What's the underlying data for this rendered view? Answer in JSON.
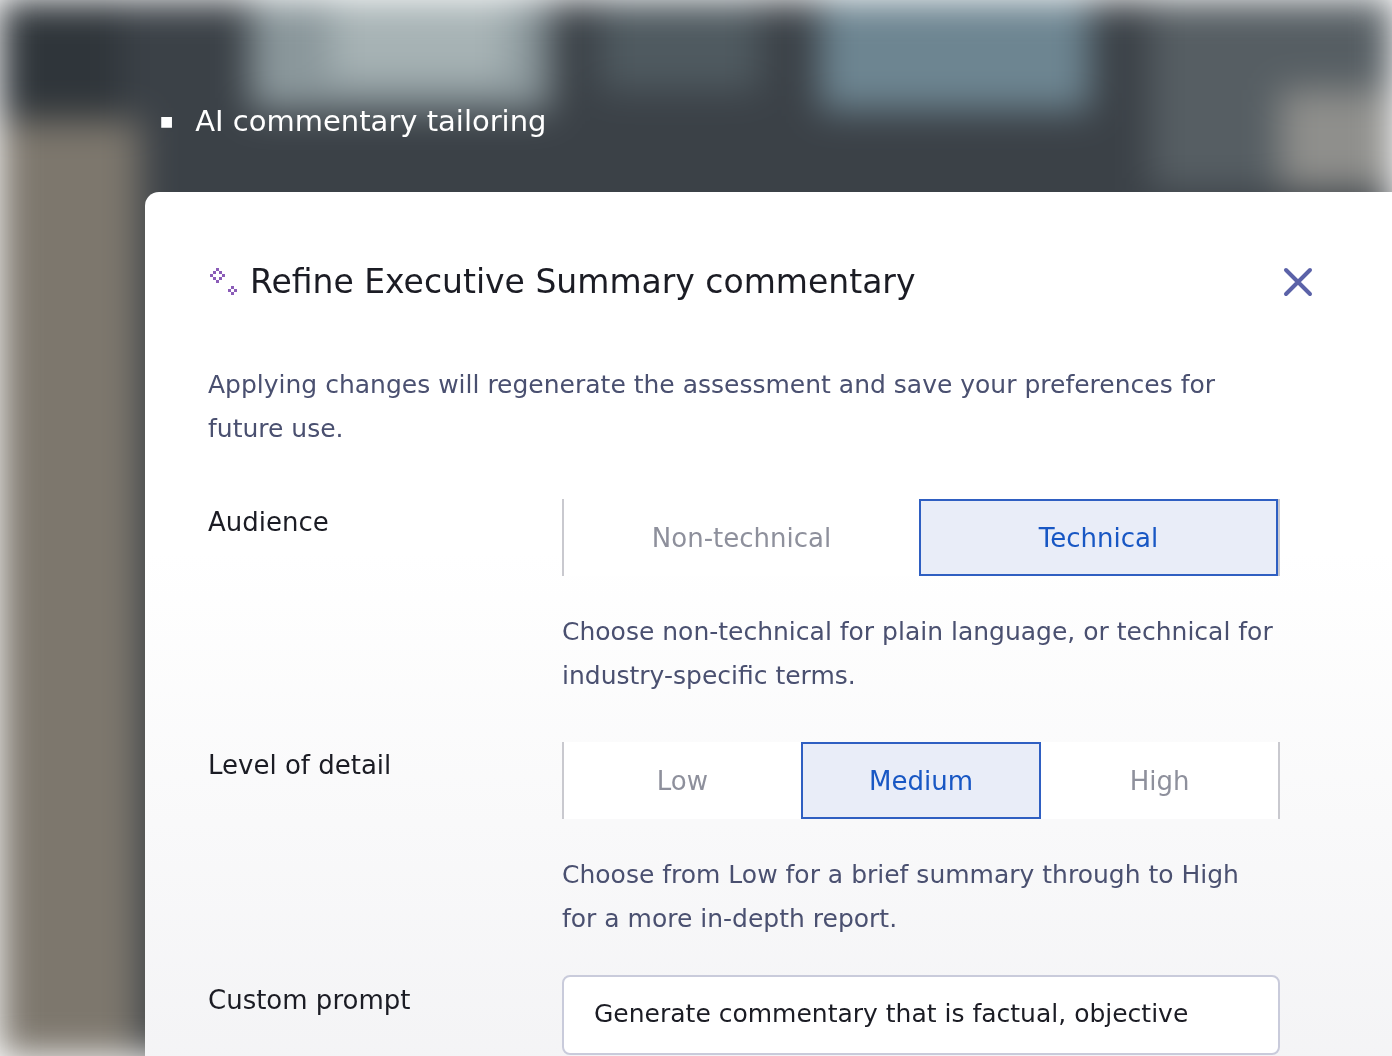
{
  "heading": {
    "bullet": "■",
    "title": "AI commentary tailoring"
  },
  "dialog": {
    "title": "Refine Executive Summary commentary",
    "description": "Applying changes will regenerate the assessment and save your preferences for future use.",
    "settings": [
      {
        "label": "Audience",
        "options": [
          {
            "label": "Non-technical",
            "selected": false
          },
          {
            "label": "Technical",
            "selected": true
          }
        ],
        "help": "Choose non-technical for plain language, or technical for industry-specific terms."
      },
      {
        "label": "Level of detail",
        "options": [
          {
            "label": "Low",
            "selected": false
          },
          {
            "label": "Medium",
            "selected": true
          },
          {
            "label": "High",
            "selected": false
          }
        ],
        "help": "Choose from Low for a brief summary through to High for a more in-depth report."
      }
    ],
    "custom_prompt": {
      "label": "Custom prompt",
      "value": "Generate commentary that is factual, objective"
    }
  }
}
